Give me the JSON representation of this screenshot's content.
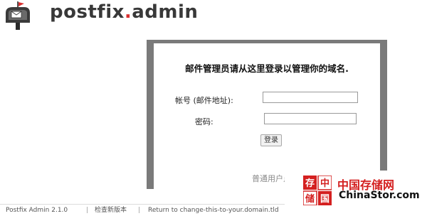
{
  "header": {
    "logo_text_main": "postfix",
    "logo_text_dot": ".",
    "logo_text_sub": "admin"
  },
  "login": {
    "title": "邮件管理员请从这里登录以管理你的域名.",
    "account_label": "帐号 (邮件地址):",
    "account_value": "",
    "password_label": "密码:",
    "password_value": "",
    "submit_label": "登录",
    "user_login_link": "普通用户点击这里进入"
  },
  "footer": {
    "version": "Postfix Admin 2.1.0",
    "separator": "|",
    "check_update": "检查新版本",
    "return_link": "Return to change-this-to-your.domain.tld"
  },
  "watermark": {
    "cn_text": "中国存储网",
    "url_text": "ChinaStor.com",
    "seal_chars": [
      "存",
      "中",
      "储",
      "国"
    ]
  },
  "colors": {
    "panel_border": "#7a7a7a",
    "logo_accent": "#d93030",
    "watermark_red": "#d42020"
  }
}
